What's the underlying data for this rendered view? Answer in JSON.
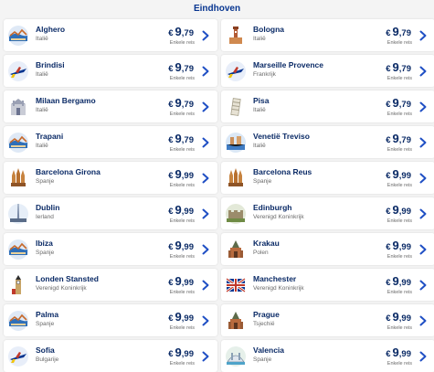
{
  "header": {
    "title": "Eindhoven"
  },
  "currency": "€",
  "colors": {
    "brand_blue": "#073590",
    "chevron": "#1f4fc4"
  },
  "destinations": [
    {
      "city": "Alghero",
      "country": "Italië",
      "price_int": "9",
      "price_dec": ",79",
      "subtitle": "Enkele reis",
      "icon": "coastal-view-icon"
    },
    {
      "city": "Bologna",
      "country": "Italië",
      "price_int": "9",
      "price_dec": ",79",
      "subtitle": "Enkele reis",
      "icon": "tower-icon"
    },
    {
      "city": "Brindisi",
      "country": "Italië",
      "price_int": "9",
      "price_dec": ",79",
      "subtitle": "Enkele reis",
      "icon": "airplane-icon"
    },
    {
      "city": "Marseille Provence",
      "country": "Frankrijk",
      "price_int": "9",
      "price_dec": ",79",
      "subtitle": "Enkele reis",
      "icon": "airplane-icon"
    },
    {
      "city": "Milaan Bergamo",
      "country": "Italië",
      "price_int": "9",
      "price_dec": ",79",
      "subtitle": "Enkele reis",
      "icon": "cathedral-icon"
    },
    {
      "city": "Pisa",
      "country": "Italië",
      "price_int": "9",
      "price_dec": ",79",
      "subtitle": "Enkele reis",
      "icon": "leaning-tower-icon"
    },
    {
      "city": "Trapani",
      "country": "Italië",
      "price_int": "9",
      "price_dec": ",79",
      "subtitle": "Enkele reis",
      "icon": "coastal-view-icon"
    },
    {
      "city": "Venetië Treviso",
      "country": "Italië",
      "price_int": "9",
      "price_dec": ",79",
      "subtitle": "Enkele reis",
      "icon": "gondola-icon"
    },
    {
      "city": "Barcelona Girona",
      "country": "Spanje",
      "price_int": "9",
      "price_dec": ",99",
      "subtitle": "Enkele reis",
      "icon": "sagrada-familia-icon"
    },
    {
      "city": "Barcelona Reus",
      "country": "Spanje",
      "price_int": "9",
      "price_dec": ",99",
      "subtitle": "Enkele reis",
      "icon": "sagrada-familia-icon"
    },
    {
      "city": "Dublin",
      "country": "Ierland",
      "price_int": "9",
      "price_dec": ",99",
      "subtitle": "Enkele reis",
      "icon": "spire-icon"
    },
    {
      "city": "Edinburgh",
      "country": "Verenigd Koninkrijk",
      "price_int": "9",
      "price_dec": ",99",
      "subtitle": "Enkele reis",
      "icon": "castle-icon"
    },
    {
      "city": "Ibiza",
      "country": "Spanje",
      "price_int": "9",
      "price_dec": ",99",
      "subtitle": "Enkele reis",
      "icon": "coastal-view-icon"
    },
    {
      "city": "Krakau",
      "country": "Polen",
      "price_int": "9",
      "price_dec": ",99",
      "subtitle": "Enkele reis",
      "icon": "church-icon"
    },
    {
      "city": "Londen Stansted",
      "country": "Verenigd Koninkrijk",
      "price_int": "9",
      "price_dec": ",99",
      "subtitle": "Enkele reis",
      "icon": "big-ben-icon"
    },
    {
      "city": "Manchester",
      "country": "Verenigd Koninkrijk",
      "price_int": "9",
      "price_dec": ",99",
      "subtitle": "Enkele reis",
      "icon": "union-jack-icon"
    },
    {
      "city": "Palma",
      "country": "Spanje",
      "price_int": "9",
      "price_dec": ",99",
      "subtitle": "Enkele reis",
      "icon": "coastal-view-icon"
    },
    {
      "city": "Prague",
      "country": "Tsjechië",
      "price_int": "9",
      "price_dec": ",99",
      "subtitle": "Enkele reis",
      "icon": "church-icon"
    },
    {
      "city": "Sofia",
      "country": "Bulgarije",
      "price_int": "9",
      "price_dec": ",99",
      "subtitle": "Enkele reis",
      "icon": "airplane-icon"
    },
    {
      "city": "Valencia",
      "country": "Spanje",
      "price_int": "9",
      "price_dec": ",99",
      "subtitle": "Enkele reis",
      "icon": "city-of-arts-icon"
    }
  ]
}
